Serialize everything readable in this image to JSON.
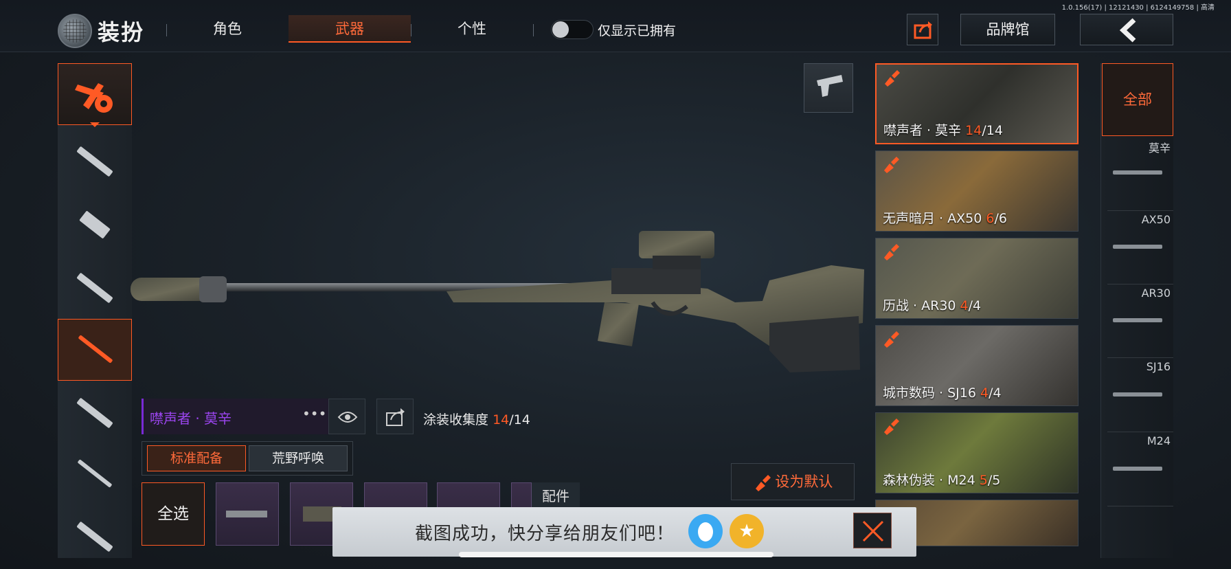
{
  "version": "1.0.156(17) | 12121430 | 6124149758 | 高清",
  "header": {
    "title": "装扮",
    "tabs": [
      {
        "label": "角色",
        "active": false
      },
      {
        "label": "武器",
        "active": true
      },
      {
        "label": "个性",
        "active": false
      }
    ],
    "owned_only_label": "仅显示已拥有",
    "owned_only_on": false,
    "brand_button": "品牌馆"
  },
  "colors": {
    "accent": "#ff5a25",
    "purple": "#9b45ef"
  },
  "weapon": {
    "name": "噤声者 · 莫辛",
    "collection_label": "涂装收集度",
    "collection_owned": "14",
    "collection_total": "/14"
  },
  "loadout_tabs": [
    "标准配备",
    "荒野呼唤"
  ],
  "select_all": "全选",
  "accessory_label": "配件",
  "set_default": "设为默认",
  "skins": [
    {
      "name": "噤声者 · 莫辛 ",
      "owned": "14",
      "total": "/14",
      "selected": true
    },
    {
      "name": "无声暗月 · AX50 ",
      "owned": "6",
      "total": "/6",
      "selected": false
    },
    {
      "name": "历战 · AR30 ",
      "owned": "4",
      "total": "/4",
      "selected": false
    },
    {
      "name": "城市数码 · SJ16 ",
      "owned": "4",
      "total": "/4",
      "selected": false
    },
    {
      "name": "森林伪装 · M24 ",
      "owned": "5",
      "total": "/5",
      "selected": false
    }
  ],
  "categories": {
    "all": "全部",
    "items": [
      "莫辛",
      "AX50",
      "AR30",
      "SJ16",
      "M24"
    ]
  },
  "toast": {
    "message": "截图成功，快分享给朋友们吧！"
  }
}
